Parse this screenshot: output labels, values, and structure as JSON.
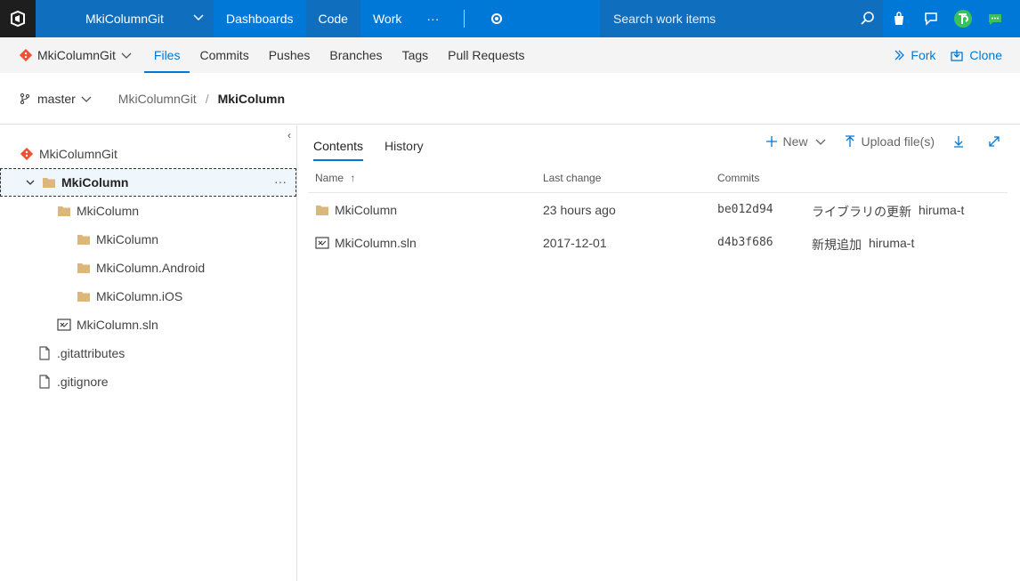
{
  "topbar": {
    "project": "MkiColumnGit",
    "nav": [
      "Dashboards",
      "Code",
      "Work"
    ],
    "more": "···",
    "search_placeholder": "Search work items"
  },
  "subbar": {
    "repo": "MkiColumnGit",
    "tabs": [
      "Files",
      "Commits",
      "Pushes",
      "Branches",
      "Tags",
      "Pull Requests"
    ],
    "fork": "Fork",
    "clone": "Clone"
  },
  "crumb": {
    "branch": "master",
    "path1": "MkiColumnGit",
    "slash": "/",
    "path2": "MkiColumn"
  },
  "tree": {
    "collapse": "‹",
    "root": "MkiColumnGit",
    "selected": "MkiColumn",
    "more": "···",
    "items": [
      {
        "label": "MkiColumn"
      },
      {
        "label": "MkiColumn"
      },
      {
        "label": "MkiColumn.Android"
      },
      {
        "label": "MkiColumn.iOS"
      },
      {
        "label": "MkiColumn.sln"
      },
      {
        "label": ".gitattributes"
      },
      {
        "label": ".gitignore"
      }
    ]
  },
  "pane": {
    "tabs": [
      "Contents",
      "History"
    ],
    "new": "New",
    "upload": "Upload file(s)",
    "headers": {
      "name": "Name",
      "sort": "↑",
      "last_change": "Last change",
      "commits": "Commits"
    },
    "rows": [
      {
        "name": "MkiColumn",
        "last_change": "23 hours ago",
        "commit": "be012d94",
        "message": "ライブラリの更新",
        "author": "hiruma-t"
      },
      {
        "name": "MkiColumn.sln",
        "last_change": "2017-12-01",
        "commit": "d4b3f686",
        "message": "新規追加",
        "author": "hiruma-t"
      }
    ]
  },
  "colors": {
    "accent": "#0078d7",
    "folder": "#dcb67a",
    "git": "#f05133"
  }
}
